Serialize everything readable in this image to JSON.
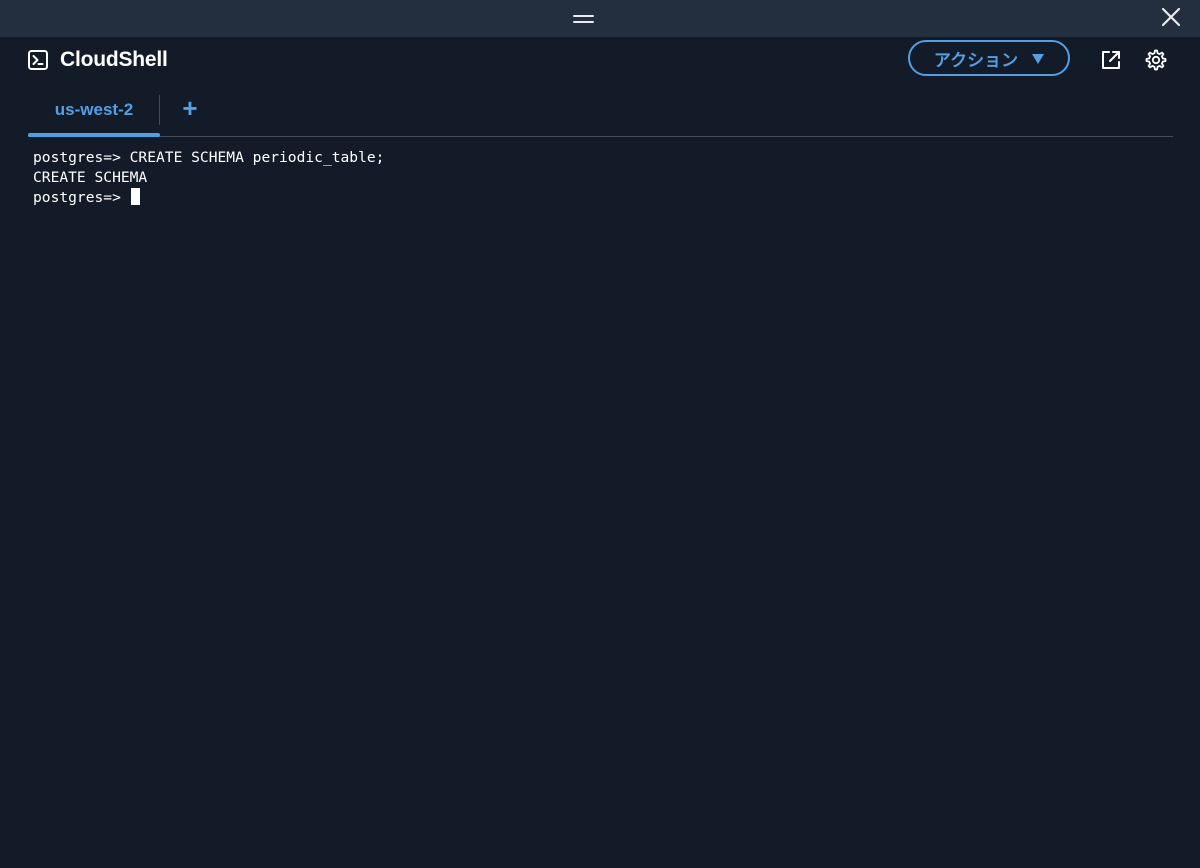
{
  "window": {
    "close_icon": "close-icon",
    "drag_icon": "drag-handle-icon"
  },
  "header": {
    "title": "CloudShell",
    "title_icon": "terminal-icon",
    "actions_label": "アクション",
    "actions_icon": "caret-down-icon",
    "external_icon": "external-link-icon",
    "settings_icon": "gear-icon"
  },
  "tabs": {
    "items": [
      {
        "label": "us-west-2",
        "active": true
      }
    ],
    "add_label": "+"
  },
  "terminal": {
    "lines": [
      "postgres=> CREATE SCHEMA periodic_table;",
      "CREATE SCHEMA",
      "postgres=> "
    ]
  },
  "colors": {
    "background": "#131b28",
    "topbar": "#232f3e",
    "accent": "#539fe5",
    "text": "#ffffff",
    "divider": "#414d5c"
  }
}
